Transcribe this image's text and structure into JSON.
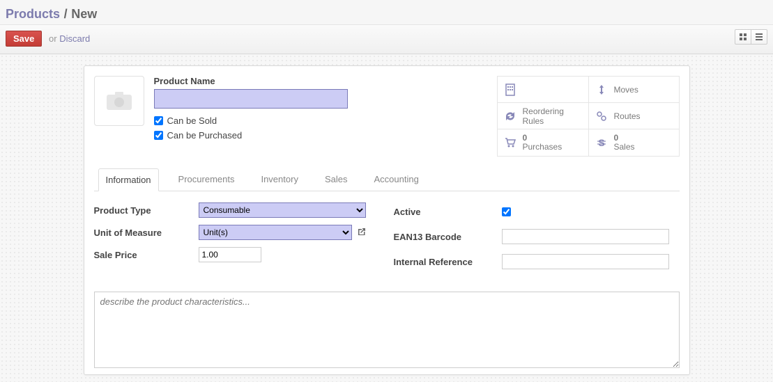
{
  "breadcrumb": {
    "root": "Products",
    "sep": "/",
    "leaf": "New"
  },
  "actions": {
    "save": "Save",
    "or": "or",
    "discard": "Discard"
  },
  "form": {
    "name_label": "Product Name",
    "name_value": "",
    "can_be_sold_label": "Can be Sold",
    "can_be_sold": true,
    "can_be_purchased_label": "Can be Purchased",
    "can_be_purchased": true
  },
  "stats": {
    "s1_label": "",
    "s2_label": "Moves",
    "s3_label": "Reordering Rules",
    "s4_label": "Routes",
    "s5_count": "0",
    "s5_label": "Purchases",
    "s6_count": "0",
    "s6_label": "Sales"
  },
  "tabs": [
    "Information",
    "Procurements",
    "Inventory",
    "Sales",
    "Accounting"
  ],
  "info": {
    "product_type_label": "Product Type",
    "product_type_value": "Consumable",
    "uom_label": "Unit of Measure",
    "uom_value": "Unit(s)",
    "sale_price_label": "Sale Price",
    "sale_price_value": "1.00",
    "active_label": "Active",
    "active_value": true,
    "ean_label": "EAN13 Barcode",
    "ean_value": "",
    "ref_label": "Internal Reference",
    "ref_value": "",
    "desc_placeholder": "describe the product characteristics..."
  }
}
